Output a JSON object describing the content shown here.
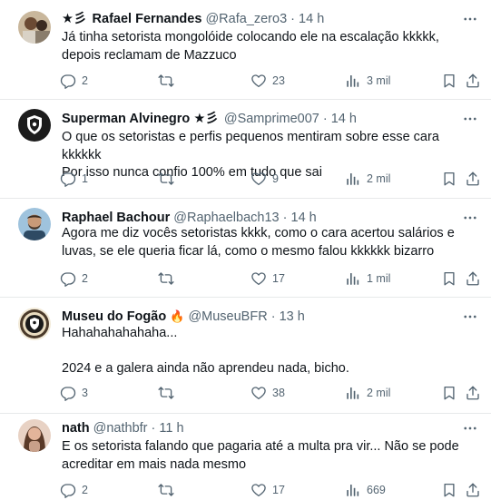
{
  "tweets": [
    {
      "name": "Rafael Fernandes",
      "badge": "★彡",
      "handle": "@Rafa_zero3",
      "separator": "·",
      "time": "14 h",
      "text": "Já tinha setorista mongolóide colocando ele na escalação kkkkk, depois reclamam de Mazzuco",
      "replies": "2",
      "retweets": "",
      "likes": "23",
      "views": "3 mil"
    },
    {
      "name": "Superman Alvinegro",
      "badge_suffix": "★彡",
      "handle": "@Samprime007",
      "separator": "·",
      "time": "14 h",
      "text": "O que os setoristas e perfis pequenos mentiram sobre esse cara kkkkkk\nPor isso nunca confio 100% em tudo que sai",
      "replies": "1",
      "retweets": "",
      "likes": "9",
      "views": "2 mil"
    },
    {
      "name": "Raphael Bachour",
      "handle": "@Raphaelbach13",
      "separator": "·",
      "time": "14 h",
      "text": "Agora me diz vocês setoristas kkkk, como o cara acertou salários e luvas, se ele queria ficar lá, como o mesmo falou kkkkkk bizarro",
      "replies": "2",
      "retweets": "",
      "likes": "17",
      "views": "1 mil"
    },
    {
      "name": "Museu do Fogão",
      "emoji": "🔥",
      "handle": "@MuseuBFR",
      "separator": "·",
      "time": "13 h",
      "text": "Hahahahahahaha...\n\n2024 e a galera ainda não aprendeu nada, bicho.",
      "replies": "3",
      "retweets": "",
      "likes": "38",
      "views": "2 mil"
    },
    {
      "name": "nath",
      "handle": "@nathbfr",
      "separator": "·",
      "time": "11 h",
      "text": "E os setorista falando que pagaria até a multa pra vir... Não se pode acreditar em mais nada mesmo",
      "replies": "2",
      "retweets": "",
      "likes": "17",
      "views": "669"
    }
  ],
  "icons": {
    "reply": "reply-icon",
    "retweet": "retweet-icon",
    "like": "heart-icon",
    "views": "views-icon",
    "bookmark": "bookmark-icon",
    "share": "share-icon",
    "more": "more-icon"
  },
  "colors": {
    "text": "#0f1419",
    "secondary": "#536471",
    "divider": "#e7e9ea"
  }
}
